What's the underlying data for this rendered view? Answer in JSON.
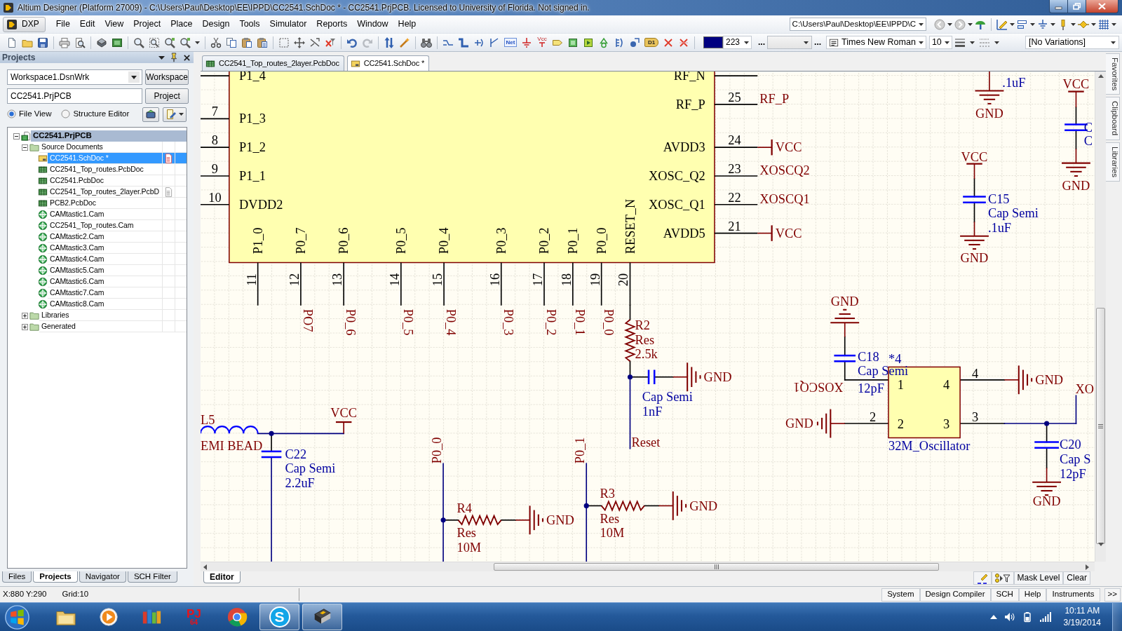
{
  "window": {
    "title": "Altium Designer (Platform 27009) - C:\\Users\\Paul\\Desktop\\EE\\IPPD\\CC2541.SchDoc * - CC2541.PrjPCB. Licensed to University of Florida. Not signed in."
  },
  "menu": {
    "dxp": "DXP",
    "items": [
      "File",
      "Edit",
      "View",
      "Project",
      "Place",
      "Design",
      "Tools",
      "Simulator",
      "Reports",
      "Window",
      "Help"
    ],
    "path": "C:\\Users\\Paul\\Desktop\\EE\\IPPD\\C"
  },
  "toolbar": {
    "icon_captions": [
      "Net",
      "Vcc",
      "D1"
    ],
    "color_index": "223",
    "more": [
      "...",
      "..."
    ],
    "font": "Times New Roman",
    "point_choice": "10",
    "variations": "[No Variations]"
  },
  "projects_panel": {
    "title": "Projects",
    "workspace": "Workspace1.DsnWrk",
    "workspace_button": "Workspace",
    "project": "CC2541.PrjPCB",
    "project_button": "Project",
    "views": [
      {
        "label": "File View",
        "selected": true
      },
      {
        "label": "Structure Editor",
        "selected": false
      }
    ],
    "tree": {
      "label": "CC2541.PrjPCB",
      "kind": "project",
      "expanded": true,
      "highlighted": true,
      "children": [
        {
          "label": "Source Documents",
          "kind": "folder",
          "expanded": true,
          "selected": false,
          "children": [
            {
              "label": "CC2541.SchDoc *",
              "kind": "schematic",
              "selected": true,
              "open": true,
              "modified": true
            },
            {
              "label": "CC2541_Top_routes.PcbDoc",
              "kind": "pcb",
              "selected": false,
              "open": false,
              "modified": false
            },
            {
              "label": "CC2541.PcbDoc",
              "kind": "pcb",
              "selected": false,
              "open": false,
              "modified": false
            },
            {
              "label": "CC2541_Top_routes_2layer.PcbD",
              "kind": "pcb",
              "selected": false,
              "open": true,
              "modified": false
            },
            {
              "label": "PCB2.PcbDoc",
              "kind": "pcb",
              "selected": false,
              "open": false,
              "modified": false
            },
            {
              "label": "CAMtastic1.Cam",
              "kind": "cam",
              "selected": false,
              "open": false,
              "modified": false
            },
            {
              "label": "CC2541_Top_routes.Cam",
              "kind": "cam",
              "selected": false,
              "open": false,
              "modified": false
            },
            {
              "label": "CAMtastic2.Cam",
              "kind": "cam",
              "selected": false,
              "open": false,
              "modified": false
            },
            {
              "label": "CAMtastic3.Cam",
              "kind": "cam",
              "selected": false,
              "open": false,
              "modified": false
            },
            {
              "label": "CAMtastic4.Cam",
              "kind": "cam",
              "selected": false,
              "open": false,
              "modified": false
            },
            {
              "label": "CAMtastic5.Cam",
              "kind": "cam",
              "selected": false,
              "open": false,
              "modified": false
            },
            {
              "label": "CAMtastic6.Cam",
              "kind": "cam",
              "selected": false,
              "open": false,
              "modified": false
            },
            {
              "label": "CAMtastic7.Cam",
              "kind": "cam",
              "selected": false,
              "open": false,
              "modified": false
            },
            {
              "label": "CAMtastic8.Cam",
              "kind": "cam",
              "selected": false,
              "open": false,
              "modified": false
            }
          ]
        },
        {
          "label": "Libraries",
          "kind": "folder",
          "expanded": false,
          "selected": false
        },
        {
          "label": "Generated",
          "kind": "folder",
          "expanded": false,
          "selected": false
        }
      ]
    },
    "tabs": [
      {
        "label": "Files",
        "selected": false
      },
      {
        "label": "Projects",
        "selected": true
      },
      {
        "label": "Navigator",
        "selected": false
      },
      {
        "label": "SCH Filter",
        "selected": false
      }
    ]
  },
  "doc_tabs": [
    {
      "label": "CC2541_Top_routes_2layer.PcbDoc",
      "kind": "pcb",
      "selected": false
    },
    {
      "label": "CC2541.SchDoc *",
      "kind": "schematic",
      "selected": true
    }
  ],
  "schematic": {
    "chip": {
      "left_pins": [
        {
          "name": "P1_4"
        },
        {
          "number": "7",
          "name": "P1_3"
        },
        {
          "number": "8",
          "name": "P1_2"
        },
        {
          "number": "9",
          "name": "P1_1"
        },
        {
          "number": "10",
          "name": "DVDD2"
        }
      ],
      "right_pins": [
        {
          "name": "RF_N"
        },
        {
          "number": "25",
          "name": "RF_P"
        },
        {
          "number": "24",
          "name": "AVDD3"
        },
        {
          "number": "23",
          "name": "XOSC_Q2"
        },
        {
          "number": "22",
          "name": "XOSC_Q1"
        },
        {
          "number": "21",
          "name": "AVDD5"
        }
      ],
      "bottom_pins": [
        {
          "number": "11",
          "name": "P1_0"
        },
        {
          "number": "12",
          "name": "P0_7"
        },
        {
          "number": "13",
          "name": "P0_6"
        },
        {
          "number": "14",
          "name": "P0_5"
        },
        {
          "number": "15",
          "name": "P0_4"
        },
        {
          "number": "16",
          "name": "P0_3"
        },
        {
          "number": "17",
          "name": "P0_2"
        },
        {
          "number": "18",
          "name": "P0_1"
        },
        {
          "number": "19",
          "name": "P0_0"
        },
        {
          "number": "20",
          "name": "RESET_N"
        }
      ]
    },
    "net_labels": [
      {
        "text": "RF_P"
      },
      {
        "text": "XOSCQ2"
      },
      {
        "text": "XOSCQ1"
      },
      {
        "text": "PO7"
      },
      {
        "text": "P0_6"
      },
      {
        "text": "P0_5"
      },
      {
        "text": "P0_4"
      },
      {
        "text": "P0_3"
      },
      {
        "text": "P0_2"
      },
      {
        "text": "P0_1"
      },
      {
        "text": "P0_0"
      },
      {
        "text": "Reset"
      },
      {
        "text": "P0_0"
      },
      {
        "text": "P0_1"
      },
      {
        "text": "XOSCQ1"
      },
      {
        "text": "XO"
      }
    ],
    "power_ports": [
      {
        "kind": "vcc",
        "text": "VCC"
      },
      {
        "kind": "vcc",
        "text": "VCC"
      },
      {
        "kind": "gnd",
        "text": "GND"
      },
      {
        "kind": "vcc",
        "text": "VCC"
      },
      {
        "kind": "gnd",
        "text": "GND"
      },
      {
        "kind": "gnd",
        "text": "GND"
      },
      {
        "kind": "gnd",
        "text": "GND"
      },
      {
        "kind": "vcc",
        "text": "VCC"
      },
      {
        "kind": "gnd",
        "text": "GND"
      },
      {
        "kind": "vcc",
        "text": "VCC"
      },
      {
        "kind": "gnd",
        "text": "GND"
      },
      {
        "kind": "gnd",
        "text": "GND"
      },
      {
        "kind": "gnd",
        "text": "GND"
      },
      {
        "kind": "gnd",
        "text": "GND"
      },
      {
        "kind": "gnd",
        "text": "GND"
      }
    ],
    "components": [
      {
        "kind": "resistor",
        "designator": "R2",
        "caption": "Res",
        "value": "2.5k"
      },
      {
        "kind": "capacitor",
        "caption": "Cap Semi",
        "value": "1nF"
      },
      {
        "kind": "inductor",
        "designator": "L5",
        "caption": "EMI BEAD"
      },
      {
        "kind": "capacitor",
        "designator": "C22",
        "caption": "Cap Semi",
        "value": "2.2uF"
      },
      {
        "kind": "resistor",
        "designator": "R4",
        "caption": "Res",
        "value": "10M"
      },
      {
        "kind": "resistor",
        "designator": "R3",
        "caption": "Res",
        "value": "10M"
      },
      {
        "kind": "capacitor",
        "value": ".1uF"
      },
      {
        "kind": "capacitor",
        "designator": "C",
        "caption": "C"
      },
      {
        "kind": "capacitor",
        "designator": "C15",
        "caption": "Cap Semi",
        "value": ".1uF"
      },
      {
        "kind": "capacitor",
        "designator": "C18",
        "caption": "Cap Semi",
        "value": "12pF"
      },
      {
        "kind": "oscillator",
        "designator": "*4",
        "caption": "32M_Oscillator",
        "pin_names": [
          "1",
          "4",
          "2",
          "3"
        ],
        "pin_numbers": [
          "4",
          "2",
          "3"
        ]
      },
      {
        "kind": "capacitor",
        "designator": "C20",
        "caption": "Cap S",
        "value": "12pF"
      }
    ]
  },
  "side_tabs": [
    "Favorites",
    "Clipboard",
    "Libraries"
  ],
  "editor_bar": {
    "tabs": [
      {
        "label": "Editor",
        "selected": true
      }
    ],
    "mask_level": "Mask Level",
    "clear": "Clear"
  },
  "status_bar": {
    "coordinates": "X:880 Y:290",
    "grid": "Grid:10",
    "buttons": [
      "System",
      "Design Compiler",
      "SCH",
      "Help",
      "Instruments",
      ">>"
    ]
  },
  "taskbar": {
    "apps": [
      {
        "kind": "explorer",
        "active": false
      },
      {
        "kind": "media",
        "active": false
      },
      {
        "kind": "tiles",
        "active": false
      },
      {
        "kind": "emulator",
        "glyphs": [
          "PJ",
          "64"
        ],
        "active": false
      },
      {
        "kind": "browser",
        "active": false
      },
      {
        "kind": "messenger",
        "glyph": "S",
        "active": true
      },
      {
        "kind": "altium",
        "active": true
      }
    ],
    "time": "10:11 AM",
    "date": "3/19/2014"
  }
}
